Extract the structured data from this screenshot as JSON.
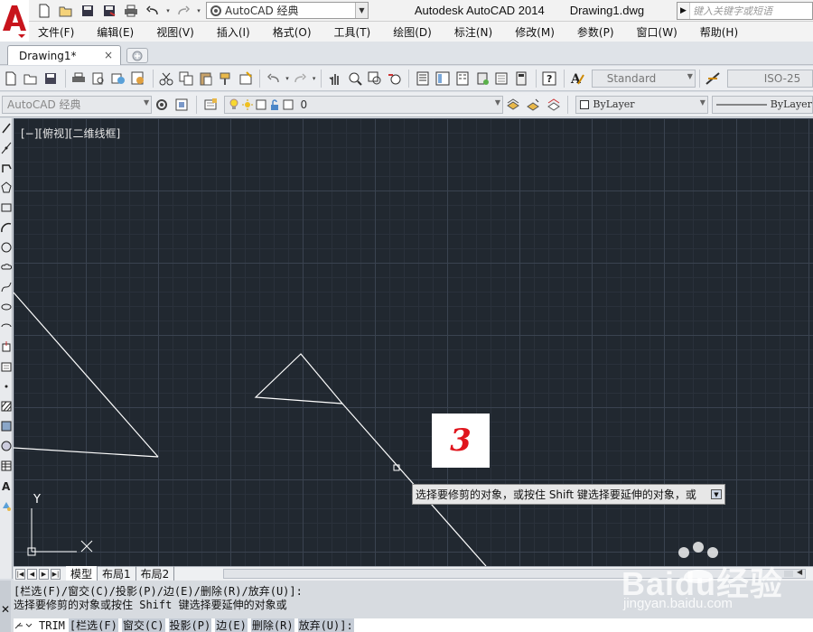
{
  "title_bar": {
    "workspace": "AutoCAD 经典",
    "app_name": "Autodesk AutoCAD 2014",
    "file_name": "Drawing1.dwg",
    "search_placeholder": "键入关键字或短语"
  },
  "menu": [
    "文件(F)",
    "编辑(E)",
    "视图(V)",
    "插入(I)",
    "格式(O)",
    "工具(T)",
    "绘图(D)",
    "标注(N)",
    "修改(M)",
    "参数(P)",
    "窗口(W)",
    "帮助(H)"
  ],
  "doc_tab": {
    "label": "Drawing1*",
    "close": "×"
  },
  "toolbar": {
    "text_style": "Standard",
    "dim_style": "ISO-25",
    "workspace_combo": "AutoCAD 经典",
    "layer_name": "0",
    "color": "ByLayer",
    "linetype": "ByLayer"
  },
  "viewport": {
    "label": "[−][俯视][二维线框]",
    "ucs_y": "Y"
  },
  "step_badge": "3",
  "tooltip": "选择要修剪的对象，或按住 Shift 键选择要延伸的对象，或",
  "layout_tabs": [
    "模型",
    "布局1",
    "布局2"
  ],
  "command": {
    "history_line1": "[栏选(F)/窗交(C)/投影(P)/边(E)/删除(R)/放弃(U)]:",
    "history_line2": "选择要修剪的对象或按住 Shift 键选择要延伸的对象或",
    "prompt": "TRIM",
    "options": [
      "[栏选(F)",
      "窗交(C)",
      "投影(P)",
      "边(E)",
      "删除(R)",
      "放弃(U)]:"
    ]
  },
  "watermark": {
    "text": "Baidu经验",
    "url": "jingyan.baidu.com"
  },
  "colors": {
    "canvas_bg": "#212830",
    "accent_red": "#e0151d",
    "line": "#ffffff"
  }
}
